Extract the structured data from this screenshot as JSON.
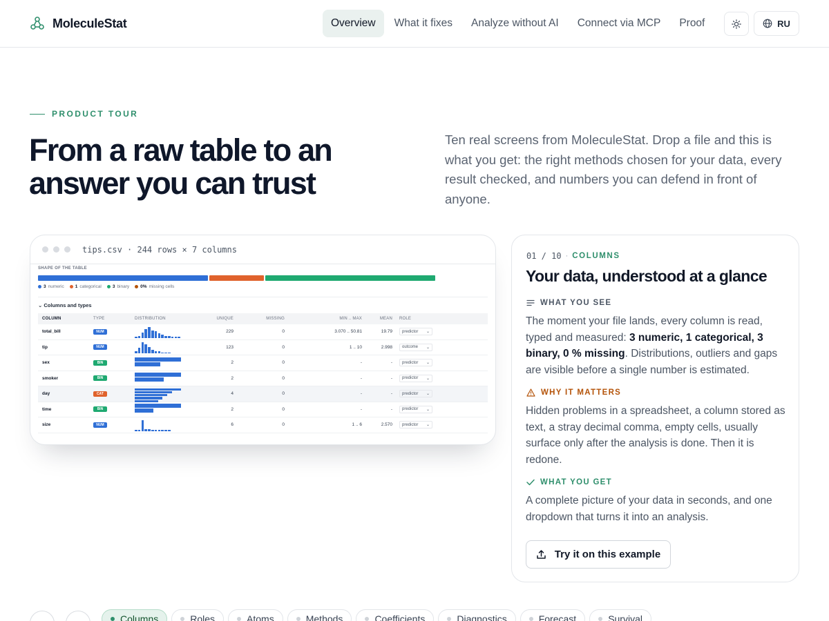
{
  "brand": {
    "name": "MoleculeStat",
    "accent": "#2f8f6c"
  },
  "nav": {
    "links": [
      "Overview",
      "What it fixes",
      "Analyze without AI",
      "Connect via MCP",
      "Proof"
    ],
    "active_index": 0,
    "theme_icon": "sun-icon",
    "lang_icon": "globe-icon",
    "lang_label": "RU"
  },
  "hero": {
    "eyebrow": "PRODUCT TOUR",
    "title": "From a raw table to an answer you can trust",
    "description": "Ten real screens from MoleculeStat. Drop a file and this is what you get: the right methods chosen for your data, every result checked, and numbers you can defend in front of anyone."
  },
  "screenshot": {
    "file_label": "tips.csv · 244 rows × 7 columns",
    "shape_caption": "SHAPE OF THE TABLE",
    "shape_segments": [
      {
        "label": "numeric",
        "count": "3",
        "fraction": 0.43,
        "color": "#2f6fd6"
      },
      {
        "label": "categorical",
        "count": "1",
        "fraction": 0.14,
        "color": "#e0622c"
      },
      {
        "label": "binary",
        "count": "3",
        "fraction": 0.43,
        "color": "#1fa971"
      },
      {
        "label": "missing cells",
        "count": "0%",
        "fraction": 0,
        "color": "#b45309"
      }
    ],
    "section_title": "Columns and types",
    "columns": [
      "COLUMN",
      "TYPE",
      "DISTRIBUTION",
      "UNIQUE",
      "MISSING",
      "MIN .. MAX",
      "MEAN",
      "ROLE"
    ],
    "type_colors": {
      "NUM": "#2f6fd6",
      "BIN": "#1fa971",
      "CAT": "#e0622c"
    },
    "rows": [
      {
        "name": "total_bill",
        "type": "NUM",
        "hist": [
          1,
          2,
          5,
          8,
          10,
          7,
          6,
          4,
          3,
          2,
          2,
          1,
          1,
          1
        ],
        "unique": "229",
        "missing": "0",
        "range": "3.070 .. 50.81",
        "mean": "19.79",
        "role": "predictor"
      },
      {
        "name": "tip",
        "type": "NUM",
        "hist": [
          2,
          5,
          10,
          8,
          6,
          3,
          2,
          2,
          1,
          1,
          1
        ],
        "unique": "123",
        "missing": "0",
        "range": "1 .. 10",
        "mean": "2.998",
        "role": "outcome"
      },
      {
        "name": "sex",
        "type": "BIN",
        "bars": [
          1.0,
          0.55
        ],
        "unique": "2",
        "missing": "0",
        "range": "-",
        "mean": "-",
        "role": "predictor"
      },
      {
        "name": "smoker",
        "type": "BIN",
        "bars": [
          1.0,
          0.62
        ],
        "unique": "2",
        "missing": "0",
        "range": "-",
        "mean": "-",
        "role": "predictor"
      },
      {
        "name": "day",
        "type": "CAT",
        "bars": [
          1.0,
          0.8,
          0.7,
          0.6,
          0.5
        ],
        "unique": "4",
        "missing": "0",
        "range": "-",
        "mean": "-",
        "role": "predictor"
      },
      {
        "name": "time",
        "type": "BIN",
        "bars": [
          1.0,
          0.4
        ],
        "unique": "2",
        "missing": "0",
        "range": "-",
        "mean": "-",
        "role": "predictor"
      },
      {
        "name": "size",
        "type": "NUM",
        "hist": [
          1,
          1,
          10,
          2,
          2,
          1,
          1,
          1,
          1,
          1,
          1
        ],
        "unique": "6",
        "missing": "0",
        "range": "1 .. 6",
        "mean": "2.570",
        "role": "predictor"
      }
    ]
  },
  "info": {
    "step": "01 / 10",
    "step_sep": "·",
    "step_name": "COLUMNS",
    "title": "Your data, understood at a glance",
    "see_label": "WHAT YOU SEE",
    "see_text_before": "The moment your file lands, every column is read, typed and measured: ",
    "see_text_bold": "3 numeric, 1 categorical, 3 binary, 0 % missing",
    "see_text_after": ". Distributions, outliers and gaps are visible before a single number is estimated.",
    "matters_label": "WHY IT MATTERS",
    "matters_text": "Hidden problems in a spreadsheet, a column stored as text, a stray decimal comma, empty cells, usually surface only after the analysis is done. Then it is redone.",
    "get_label": "WHAT YOU GET",
    "get_text": "A complete picture of your data in seconds, and one dropdown that turns it into an analysis.",
    "button_label": "Try it on this example",
    "button_icon": "upload-icon",
    "colors": {
      "see": "#4b5563",
      "matters": "#b45309",
      "get": "#2f8f6c"
    }
  },
  "tour_tabs": {
    "items": [
      "Columns",
      "Roles",
      "Atoms",
      "Methods",
      "Coefficients",
      "Diagnostics",
      "Forecast",
      "Survival"
    ],
    "active_index": 0
  }
}
